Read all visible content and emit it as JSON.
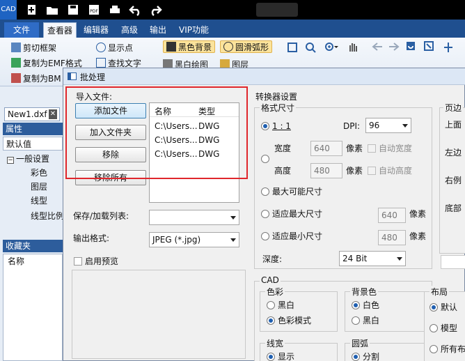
{
  "app": {
    "logo_text": "CAD"
  },
  "ribbon_tabs": [
    "文件",
    "查看器",
    "编辑器",
    "高级",
    "输出",
    "VIP功能"
  ],
  "ribbon": {
    "cut_frame": "剪切框架",
    "copy_emf": "复制为EMF格式",
    "copy_bmp": "复制为BM",
    "show_points": "显示点",
    "find_text": "查找文字",
    "black_bg": "黑色背景",
    "smooth_arc": "圆滑弧形",
    "bw_draw": "黑白绘图",
    "layers": "图层"
  },
  "left_panel": {
    "doc_tab": "New1.dxf",
    "properties_header": "属性",
    "default_value": "默认值",
    "general": "一般设置",
    "rows": [
      "彩色",
      "图层",
      "线型",
      "线型比例"
    ],
    "favorites_header": "收藏夹",
    "name_label": "名称"
  },
  "dialog": {
    "title": "批处理",
    "import_group": "导入文件:",
    "buttons": {
      "add_file": "添加文件",
      "add_folder": "加入文件夹",
      "remove": "移除",
      "remove_all": "移除所有"
    },
    "file_list": {
      "headers": [
        "名称",
        "类型"
      ],
      "rows": [
        {
          "name": "C:\\Users...",
          "type": "DWG"
        },
        {
          "name": "C:\\Users...",
          "type": "DWG"
        },
        {
          "name": "C:\\Users...",
          "type": "DWG"
        }
      ]
    },
    "save_load_list_label": "保存/加载列表:",
    "save_load_list_value": "",
    "output_format_label": "输出格式:",
    "output_format_value": "JPEG (*.jpg)",
    "preview_label": "启用预览",
    "converter_settings": "转换器设置",
    "format_size": "格式尺寸",
    "ratio": "1 : 1",
    "dpi_label": "DPI:",
    "dpi_value": "96",
    "width_label": "宽度",
    "width_value": "640",
    "pixel_unit": "像素",
    "auto_width": "自动宽度",
    "height_label": "高度",
    "height_value": "480",
    "auto_height": "自动高度",
    "max_size": "最大可能尺寸",
    "fit_max": "适应最大尺寸",
    "fit_max_value": "640",
    "fit_min": "适应最小尺寸",
    "fit_min_value": "480",
    "depth_label": "深度:",
    "depth_value": "24 Bit",
    "cad_group": "CAD",
    "color_group": "色彩",
    "bw": "黑白",
    "color_mode": "色彩模式",
    "bg_group": "背景色",
    "white": "白色",
    "black": "黑白",
    "layout_group": "布局",
    "default": "默认",
    "model": "模型",
    "all_layouts": "所有布",
    "linewidth_group": "线宽",
    "linewidth_show": "显示",
    "arc_group": "圆弧",
    "arc_segment": "分割",
    "margin_group": "页边",
    "top": "上面",
    "left": "左边",
    "right": "右例",
    "bottom": "底部"
  },
  "colors": {
    "accent": "#1f4f8f",
    "highlight_box": "#e0262c",
    "button_highlight": "#fbe39c"
  }
}
